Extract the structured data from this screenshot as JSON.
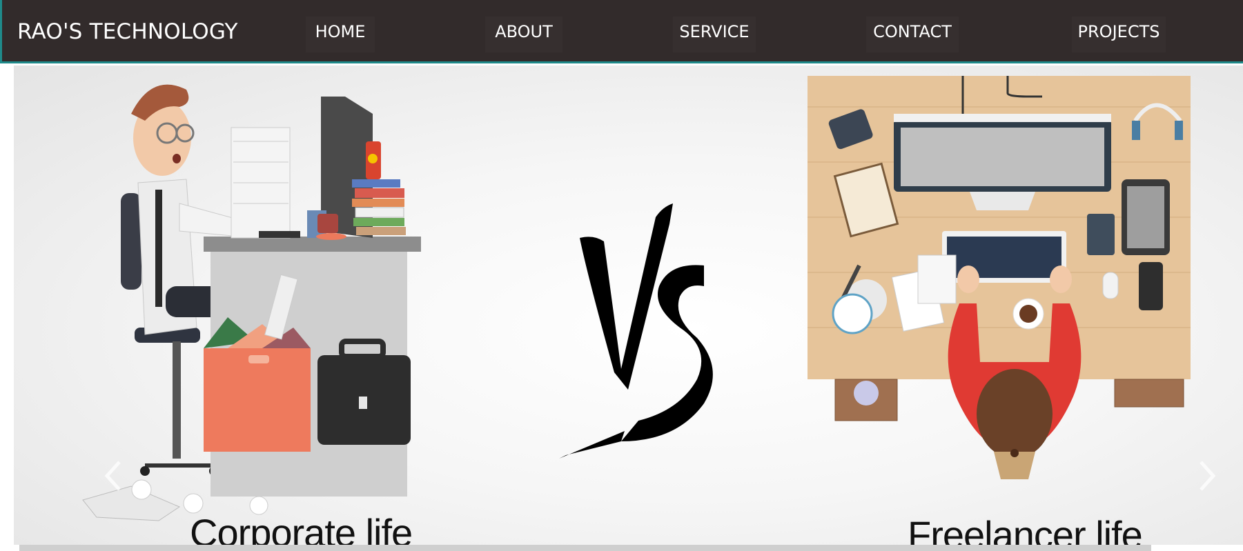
{
  "brand": {
    "title": "RAO'S TECHNOLOGY"
  },
  "nav": {
    "items": [
      {
        "label": "HOME"
      },
      {
        "label": "ABOUT"
      },
      {
        "label": "SERVICE"
      },
      {
        "label": "CONTACT"
      },
      {
        "label": "PROJECTS"
      }
    ]
  },
  "slider": {
    "left_caption": "Corporate life",
    "right_caption": "Freelancer life",
    "prev_icon": "chevron-left-icon",
    "next_icon": "chevron-right-icon"
  },
  "colors": {
    "navbar_bg": "#322b2b",
    "navbar_border": "#1f8a8a",
    "text_light": "#ffffff"
  }
}
